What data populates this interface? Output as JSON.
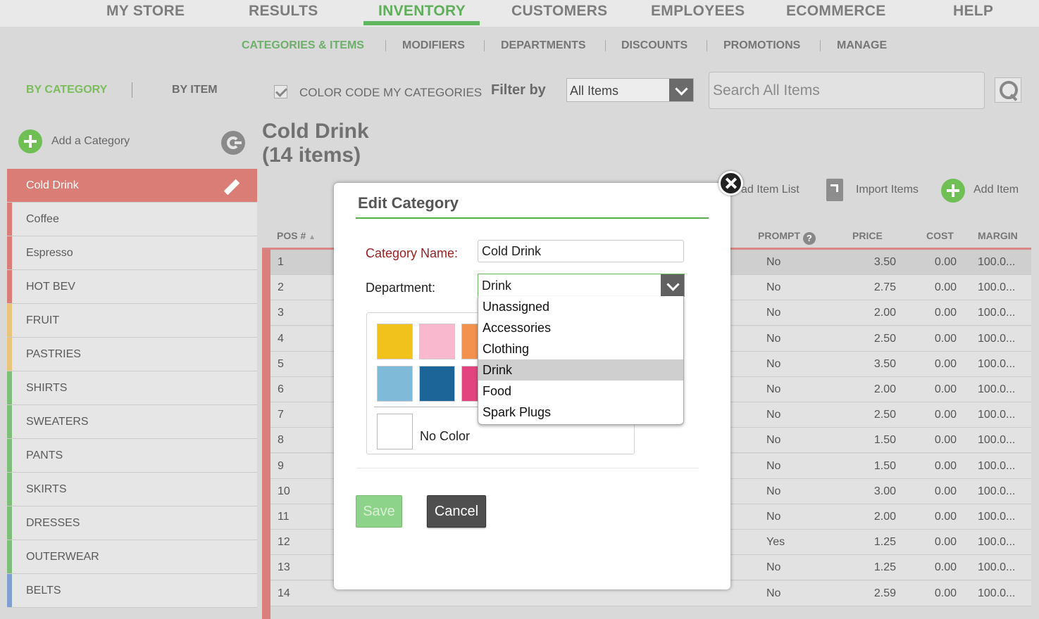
{
  "topnav": [
    "MY STORE",
    "RESULTS",
    "INVENTORY",
    "CUSTOMERS",
    "EMPLOYEES",
    "ECOMMERCE",
    "HELP"
  ],
  "subnav": [
    "CATEGORIES & ITEMS",
    "MODIFIERS",
    "DEPARTMENTS",
    "DISCOUNTS",
    "PROMOTIONS",
    "MANAGE"
  ],
  "left": {
    "by_category": "BY CATEGORY",
    "by_item": "BY ITEM",
    "add_category": "Add a Category",
    "categories": [
      {
        "label": "Cold Drink",
        "color": "#db7d77",
        "active": true
      },
      {
        "label": "Coffee",
        "color": "#db7d77"
      },
      {
        "label": "Espresso",
        "color": "#db7d77"
      },
      {
        "label": "HOT BEV",
        "color": "#db7d77"
      },
      {
        "label": "FRUIT",
        "color": "#e8c57a"
      },
      {
        "label": "PASTRIES",
        "color": "#e8c57a"
      },
      {
        "label": "SHIRTS",
        "color": "#7fbf7a"
      },
      {
        "label": "SWEATERS",
        "color": "#7fbf7a"
      },
      {
        "label": "PANTS",
        "color": "#7fbf7a"
      },
      {
        "label": "SKIRTS",
        "color": "#7fbf7a"
      },
      {
        "label": "DRESSES",
        "color": "#7fbf7a"
      },
      {
        "label": "OUTERWEAR",
        "color": "#7fbf7a"
      },
      {
        "label": "BELTS",
        "color": "#7f9fd0"
      }
    ]
  },
  "toolbar": {
    "color_code_label": "COLOR CODE MY CATEGORIES",
    "filter_label": "Filter by",
    "filter_value": "All Items",
    "search_placeholder": "Search All Items"
  },
  "main": {
    "title_line1": "Cold Drink",
    "title_line2": "(14 items)",
    "download_label": "ad Item List",
    "import_label": "Import Items",
    "add_item_label": "Add Item"
  },
  "table": {
    "headers": {
      "pos": "POS #",
      "prompt": "PROMPT",
      "price": "PRICE",
      "cost": "COST",
      "margin": "MARGIN"
    },
    "rows": [
      {
        "pos": "1",
        "prompt": "No",
        "price": "3.50",
        "cost": "0.00",
        "margin": "100.0..."
      },
      {
        "pos": "2",
        "prompt": "No",
        "price": "2.75",
        "cost": "0.00",
        "margin": "100.0..."
      },
      {
        "pos": "3",
        "prompt": "No",
        "price": "2.00",
        "cost": "0.00",
        "margin": "100.0..."
      },
      {
        "pos": "4",
        "prompt": "No",
        "price": "2.50",
        "cost": "0.00",
        "margin": "100.0..."
      },
      {
        "pos": "5",
        "prompt": "No",
        "price": "3.50",
        "cost": "0.00",
        "margin": "100.0..."
      },
      {
        "pos": "6",
        "prompt": "No",
        "price": "2.00",
        "cost": "0.00",
        "margin": "100.0..."
      },
      {
        "pos": "7",
        "prompt": "No",
        "price": "2.50",
        "cost": "0.00",
        "margin": "100.0..."
      },
      {
        "pos": "8",
        "prompt": "No",
        "price": "1.50",
        "cost": "0.00",
        "margin": "100.0..."
      },
      {
        "pos": "9",
        "prompt": "No",
        "price": "1.50",
        "cost": "0.00",
        "margin": "100.0..."
      },
      {
        "pos": "10",
        "prompt": "No",
        "price": "3.00",
        "cost": "0.00",
        "margin": "100.0..."
      },
      {
        "pos": "11",
        "prompt": "No",
        "price": "2.00",
        "cost": "0.00",
        "margin": "100.0..."
      },
      {
        "pos": "12",
        "prompt": "Yes",
        "price": "1.25",
        "cost": "0.00",
        "margin": "100.0..."
      },
      {
        "pos": "13",
        "prompt": "No",
        "price": "1.25",
        "cost": "0.00",
        "margin": "100.0..."
      },
      {
        "pos": "14",
        "prompt": "No",
        "price": "2.59",
        "cost": "0.00",
        "margin": "100.0..."
      }
    ]
  },
  "modal": {
    "title": "Edit Category",
    "category_name_label": "Category Name:",
    "category_name_value": "Cold Drink",
    "department_label": "Department:",
    "department_value": "Drink",
    "department_options": [
      "Unassigned",
      "Accessories",
      "Clothing",
      "Drink",
      "Food",
      "Spark Plugs"
    ],
    "selected_option": "Drink",
    "swatches": [
      "#f1c21b",
      "#f9b8cd",
      "#f2924e",
      "#7fbbd8",
      "#1b6599",
      "#e2447f"
    ],
    "no_color_label": "No Color",
    "save_label": "Save",
    "cancel_label": "Cancel"
  }
}
